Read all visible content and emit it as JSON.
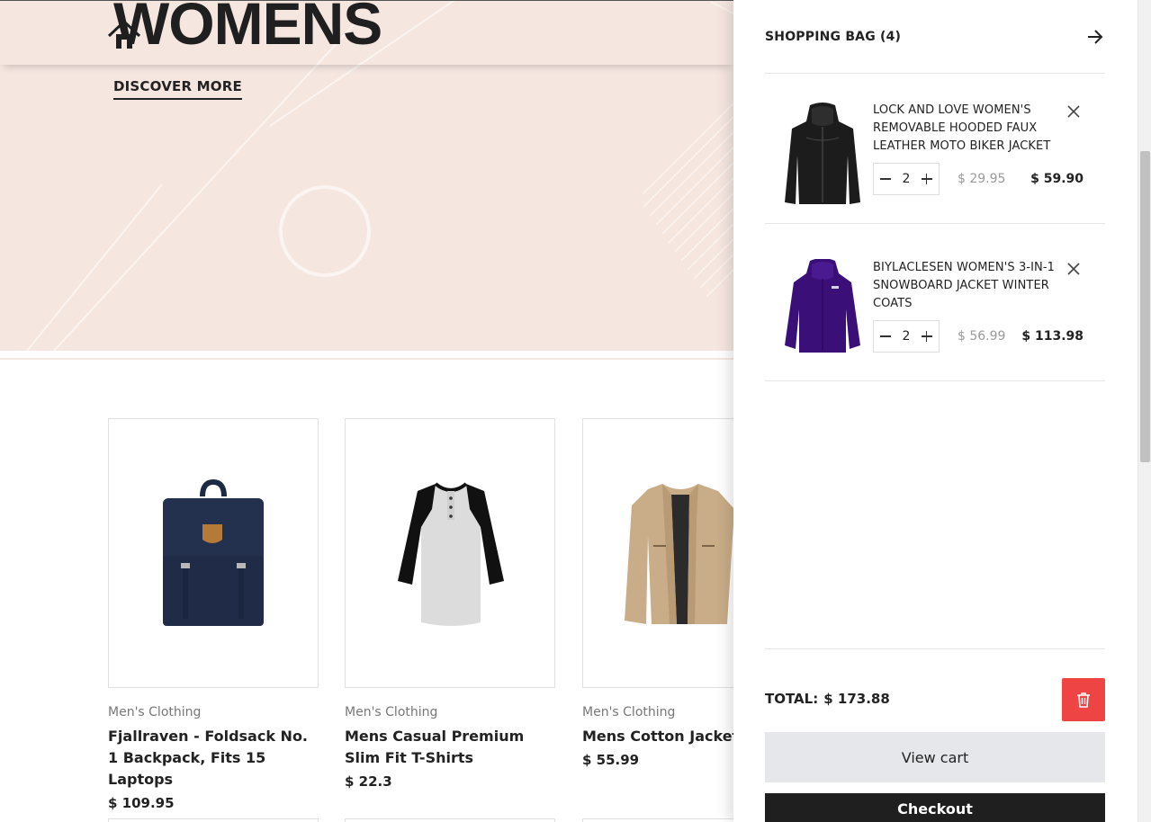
{
  "hero": {
    "title": "WOMENS",
    "discover_label": "DISCOVER MORE"
  },
  "products": [
    {
      "category": "Men's Clothing",
      "name": "Fjallraven - Foldsack No. 1 Backpack, Fits 15 Laptops",
      "price": "$ 109.95",
      "image": "backpack-image"
    },
    {
      "category": "Men's Clothing",
      "name": "Mens Casual Premium Slim Fit T-Shirts",
      "price": "$ 22.3",
      "image": "tshirt-image"
    },
    {
      "category": "Men's Clothing",
      "name": "Mens Cotton Jacket",
      "price": "$ 55.99",
      "image": "jacket-image"
    }
  ],
  "cart": {
    "title": "SHOPPING BAG (4)",
    "items": [
      {
        "title": "LOCK AND LOVE WOMEN'S REMOVABLE HOODED FAUX LEATHER MOTO BIKER JACKET",
        "quantity": "2",
        "unit_price": "$ 29.95",
        "line_total": "$ 59.90",
        "image": "black-leather-jacket-image"
      },
      {
        "title": "BIYLACLESEN WOMEN'S 3-IN-1 SNOWBOARD JACKET WINTER COATS",
        "quantity": "2",
        "unit_price": "$ 56.99",
        "line_total": "$ 113.98",
        "image": "purple-snowboard-jacket-image"
      }
    ],
    "total_label": "TOTAL:",
    "total_value": "$ 173.88",
    "view_cart_label": "View cart",
    "checkout_label": "Checkout"
  },
  "colors": {
    "hero_bg": "#f5e6e0",
    "danger": "#ef4444",
    "checkout_bg": "#1f1f1f",
    "view_cart_bg": "#e5e7eb"
  }
}
